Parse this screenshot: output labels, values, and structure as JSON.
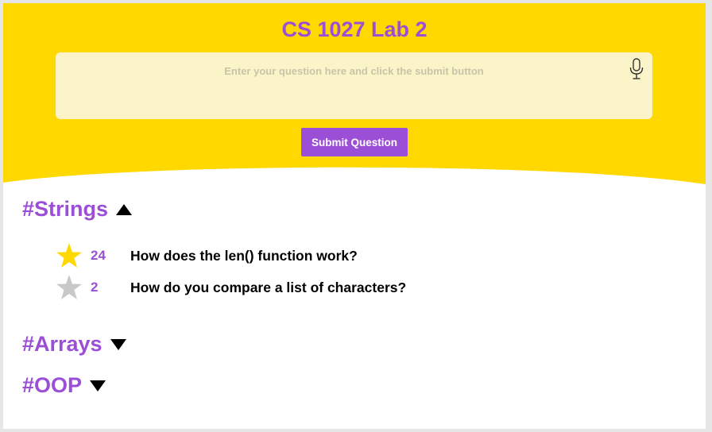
{
  "header": {
    "title": "CS 1027 Lab 2",
    "bg_color": "#ffd800"
  },
  "question_input": {
    "placeholder": "Enter your question here and click the submit button",
    "value": "",
    "mic_icon": "microphone-icon"
  },
  "submit_button": {
    "label": "Submit Question"
  },
  "sections": [
    {
      "title": "#Strings",
      "expanded": true,
      "toggle_icon": "triangle-up-icon",
      "questions": [
        {
          "votes": "24",
          "text": "How does the len() function work?",
          "starred": true,
          "star_color": "#ffd800"
        },
        {
          "votes": "2",
          "text": "How do you compare a list of characters?",
          "starred": false,
          "star_color": "#c8c8c8"
        }
      ]
    },
    {
      "title": "#Arrays",
      "expanded": false,
      "toggle_icon": "triangle-down-icon",
      "questions": []
    },
    {
      "title": "#OOP",
      "expanded": false,
      "toggle_icon": "triangle-down-icon",
      "questions": []
    }
  ],
  "colors": {
    "accent": "#9b4fd6",
    "header_yellow": "#ffd800",
    "input_bg": "#fbf4c8"
  }
}
